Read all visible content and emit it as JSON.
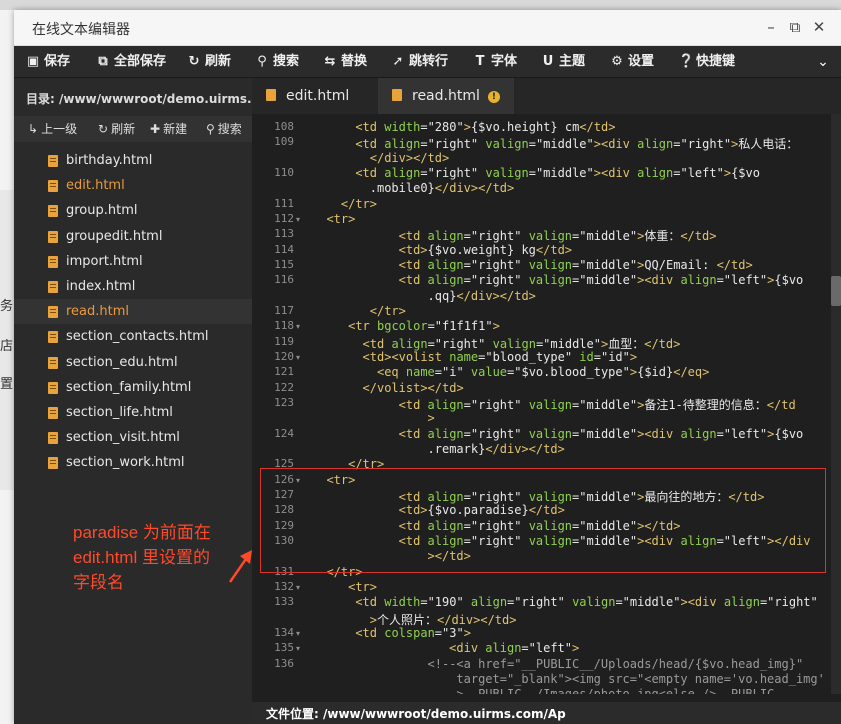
{
  "window": {
    "title": "在线文本编辑器",
    "buttons": [
      "minimize-icon",
      "maximize-icon",
      "close-icon"
    ]
  },
  "background": {
    "left_fragments": [
      "务",
      "店",
      "置"
    ]
  },
  "toolbar": {
    "items": [
      {
        "icon": "save-icon",
        "label": "保存"
      },
      {
        "icon": "save-all-icon",
        "label": "全部保存"
      },
      {
        "icon": "refresh-icon",
        "label": "刷新"
      },
      {
        "icon": "search-icon",
        "label": "搜索"
      },
      {
        "icon": "replace-icon",
        "label": "替换"
      },
      {
        "icon": "goto-line-icon",
        "label": "跳转行"
      },
      {
        "icon": "font-icon",
        "label": "字体"
      },
      {
        "icon": "theme-icon",
        "label": "主题"
      },
      {
        "icon": "gear-icon",
        "label": "设置"
      },
      {
        "icon": "help-icon",
        "label": "快捷键"
      }
    ],
    "collapse_icon": "chevron-down-icon"
  },
  "sidebar": {
    "directory": "目录: /www/wwwroot/demo.uirms.c...",
    "actions": [
      {
        "icon": "up-icon",
        "label": "上一级"
      },
      {
        "icon": "refresh-icon",
        "label": "刷新"
      },
      {
        "icon": "plus-icon",
        "label": "新建"
      },
      {
        "icon": "search-icon",
        "label": "搜索"
      }
    ],
    "files": [
      {
        "name": "birthday.html",
        "state": "normal"
      },
      {
        "name": "edit.html",
        "state": "active"
      },
      {
        "name": "group.html",
        "state": "normal"
      },
      {
        "name": "groupedit.html",
        "state": "normal"
      },
      {
        "name": "import.html",
        "state": "normal"
      },
      {
        "name": "index.html",
        "state": "normal"
      },
      {
        "name": "read.html",
        "state": "open"
      },
      {
        "name": "section_contacts.html",
        "state": "normal"
      },
      {
        "name": "section_edu.html",
        "state": "normal"
      },
      {
        "name": "section_family.html",
        "state": "normal"
      },
      {
        "name": "section_life.html",
        "state": "normal"
      },
      {
        "name": "section_visit.html",
        "state": "normal"
      },
      {
        "name": "section_work.html",
        "state": "normal"
      }
    ]
  },
  "tabs": [
    {
      "label": "edit.html"
    },
    {
      "label": "read.html",
      "modified": "!"
    }
  ],
  "code": {
    "lines": [
      {
        "n": "108",
        "fold": "",
        "ind": 6,
        "segs": [
          [
            "t",
            "<td "
          ],
          [
            "a",
            "width"
          ],
          [
            "s",
            "=\"280\""
          ],
          [
            "t",
            ">"
          ],
          [
            "s",
            "{$vo.height} cm"
          ],
          [
            "t",
            "</td>"
          ]
        ]
      },
      {
        "n": "109",
        "fold": "",
        "ind": 6,
        "segs": [
          [
            "t",
            "<td "
          ],
          [
            "a",
            "align"
          ],
          [
            "s",
            "=\"right\" "
          ],
          [
            "a",
            "valign"
          ],
          [
            "s",
            "=\"middle\""
          ],
          [
            "t",
            ">"
          ],
          [
            "t",
            "<div "
          ],
          [
            "a",
            "align"
          ],
          [
            "s",
            "=\"right\""
          ],
          [
            "t",
            ">"
          ],
          [
            "s",
            "私人电话："
          ]
        ]
      },
      {
        "n": "",
        "fold": "",
        "ind": 8,
        "segs": [
          [
            "t",
            "</div></td>"
          ]
        ]
      },
      {
        "n": "110",
        "fold": "",
        "ind": 6,
        "segs": [
          [
            "t",
            "<td "
          ],
          [
            "a",
            "align"
          ],
          [
            "s",
            "=\"right\" "
          ],
          [
            "a",
            "valign"
          ],
          [
            "s",
            "=\"middle\""
          ],
          [
            "t",
            ">"
          ],
          [
            "t",
            "<div "
          ],
          [
            "a",
            "align"
          ],
          [
            "s",
            "=\"left\""
          ],
          [
            "t",
            ">"
          ],
          [
            "s",
            "{$vo"
          ]
        ]
      },
      {
        "n": "",
        "fold": "",
        "ind": 8,
        "segs": [
          [
            "s",
            ".mobile0}"
          ],
          [
            "t",
            "</div></td>"
          ]
        ]
      },
      {
        "n": "111",
        "fold": "",
        "ind": 4,
        "segs": [
          [
            "t",
            "</tr>"
          ]
        ]
      },
      {
        "n": "112",
        "fold": "▾",
        "ind": 2,
        "segs": [
          [
            "t",
            "<tr>"
          ]
        ]
      },
      {
        "n": "113",
        "fold": "",
        "ind": 12,
        "segs": [
          [
            "t",
            "<td "
          ],
          [
            "a",
            "align"
          ],
          [
            "s",
            "=\"right\" "
          ],
          [
            "a",
            "valign"
          ],
          [
            "s",
            "=\"middle\""
          ],
          [
            "t",
            ">"
          ],
          [
            "s",
            "体重："
          ],
          [
            "t",
            "</td>"
          ]
        ]
      },
      {
        "n": "114",
        "fold": "",
        "ind": 12,
        "segs": [
          [
            "t",
            "<td>"
          ],
          [
            "s",
            "{$vo.weight} kg"
          ],
          [
            "t",
            "</td>"
          ]
        ]
      },
      {
        "n": "115",
        "fold": "",
        "ind": 12,
        "segs": [
          [
            "t",
            "<td "
          ],
          [
            "a",
            "align"
          ],
          [
            "s",
            "=\"right\" "
          ],
          [
            "a",
            "valign"
          ],
          [
            "s",
            "=\"middle\""
          ],
          [
            "t",
            ">"
          ],
          [
            "s",
            "QQ/Email: "
          ],
          [
            "t",
            "</td>"
          ]
        ]
      },
      {
        "n": "116",
        "fold": "",
        "ind": 12,
        "segs": [
          [
            "t",
            "<td "
          ],
          [
            "a",
            "align"
          ],
          [
            "s",
            "=\"right\" "
          ],
          [
            "a",
            "valign"
          ],
          [
            "s",
            "=\"middle\""
          ],
          [
            "t",
            ">"
          ],
          [
            "t",
            "<div "
          ],
          [
            "a",
            "align"
          ],
          [
            "s",
            "=\"left\""
          ],
          [
            "t",
            ">"
          ],
          [
            "s",
            "{$vo"
          ]
        ]
      },
      {
        "n": "",
        "fold": "",
        "ind": 16,
        "segs": [
          [
            "s",
            ".qq}"
          ],
          [
            "t",
            "</div></td>"
          ]
        ]
      },
      {
        "n": "117",
        "fold": "",
        "ind": 8,
        "segs": [
          [
            "t",
            "</tr>"
          ]
        ]
      },
      {
        "n": "118",
        "fold": "▾",
        "ind": 5,
        "segs": [
          [
            "t",
            "<tr "
          ],
          [
            "a",
            "bgcolor"
          ],
          [
            "s",
            "=\"f1f1f1\""
          ],
          [
            "t",
            ">"
          ]
        ]
      },
      {
        "n": "119",
        "fold": "",
        "ind": 7,
        "segs": [
          [
            "t",
            "<td "
          ],
          [
            "a",
            "align"
          ],
          [
            "s",
            "=\"right\" "
          ],
          [
            "a",
            "valign"
          ],
          [
            "s",
            "=\"middle\""
          ],
          [
            "t",
            ">"
          ],
          [
            "s",
            "血型："
          ],
          [
            "t",
            "</td>"
          ]
        ]
      },
      {
        "n": "120",
        "fold": "▾",
        "ind": 7,
        "segs": [
          [
            "t",
            "<td>"
          ],
          [
            "t",
            "<volist "
          ],
          [
            "a",
            "name"
          ],
          [
            "s",
            "=\"blood_type\" "
          ],
          [
            "a",
            "id"
          ],
          [
            "s",
            "=\"id\""
          ],
          [
            "t",
            ">"
          ]
        ]
      },
      {
        "n": "121",
        "fold": "",
        "ind": 9,
        "segs": [
          [
            "t",
            "<eq "
          ],
          [
            "a",
            "name"
          ],
          [
            "s",
            "=\"i\" "
          ],
          [
            "a",
            "value"
          ],
          [
            "s",
            "=\"$vo.blood_type\""
          ],
          [
            "t",
            ">"
          ],
          [
            "s",
            "{$id}"
          ],
          [
            "t",
            "</eq>"
          ]
        ]
      },
      {
        "n": "122",
        "fold": "",
        "ind": 7,
        "segs": [
          [
            "t",
            "</volist></td>"
          ]
        ]
      },
      {
        "n": "123",
        "fold": "",
        "ind": 12,
        "segs": [
          [
            "t",
            "<td "
          ],
          [
            "a",
            "align"
          ],
          [
            "s",
            "=\"right\" "
          ],
          [
            "a",
            "valign"
          ],
          [
            "s",
            "=\"middle\""
          ],
          [
            "t",
            ">"
          ],
          [
            "s",
            "备注1-待整理的信息："
          ],
          [
            "t",
            "</td"
          ]
        ]
      },
      {
        "n": "",
        "fold": "",
        "ind": 16,
        "segs": [
          [
            "t",
            ">"
          ]
        ]
      },
      {
        "n": "124",
        "fold": "",
        "ind": 12,
        "segs": [
          [
            "t",
            "<td "
          ],
          [
            "a",
            "align"
          ],
          [
            "s",
            "=\"right\" "
          ],
          [
            "a",
            "valign"
          ],
          [
            "s",
            "=\"middle\""
          ],
          [
            "t",
            ">"
          ],
          [
            "t",
            "<div "
          ],
          [
            "a",
            "align"
          ],
          [
            "s",
            "=\"left\""
          ],
          [
            "t",
            ">"
          ],
          [
            "s",
            "{$vo"
          ]
        ]
      },
      {
        "n": "",
        "fold": "",
        "ind": 16,
        "segs": [
          [
            "s",
            ".remark}"
          ],
          [
            "t",
            "</div></td>"
          ]
        ]
      },
      {
        "n": "125",
        "fold": "",
        "ind": 5,
        "segs": [
          [
            "t",
            "</tr>"
          ]
        ]
      },
      {
        "n": "126",
        "fold": "▾",
        "ind": 2,
        "segs": [
          [
            "t",
            "<tr>"
          ]
        ]
      },
      {
        "n": "127",
        "fold": "",
        "ind": 12,
        "segs": [
          [
            "t",
            "<td "
          ],
          [
            "a",
            "align"
          ],
          [
            "s",
            "=\"right\" "
          ],
          [
            "a",
            "valign"
          ],
          [
            "s",
            "=\"middle\""
          ],
          [
            "t",
            ">"
          ],
          [
            "s",
            "最向往的地方："
          ],
          [
            "t",
            "</td>"
          ]
        ]
      },
      {
        "n": "128",
        "fold": "",
        "ind": 12,
        "segs": [
          [
            "t",
            "<td>"
          ],
          [
            "s",
            "{$vo.paradise}"
          ],
          [
            "t",
            "</td>"
          ]
        ]
      },
      {
        "n": "129",
        "fold": "",
        "ind": 12,
        "segs": [
          [
            "t",
            "<td "
          ],
          [
            "a",
            "align"
          ],
          [
            "s",
            "=\"right\" "
          ],
          [
            "a",
            "valign"
          ],
          [
            "s",
            "=\"middle\""
          ],
          [
            "t",
            "></td>"
          ]
        ]
      },
      {
        "n": "130",
        "fold": "",
        "ind": 12,
        "segs": [
          [
            "t",
            "<td "
          ],
          [
            "a",
            "align"
          ],
          [
            "s",
            "=\"right\" "
          ],
          [
            "a",
            "valign"
          ],
          [
            "s",
            "=\"middle\""
          ],
          [
            "t",
            ">"
          ],
          [
            "t",
            "<div "
          ],
          [
            "a",
            "align"
          ],
          [
            "s",
            "=\"left\""
          ],
          [
            "t",
            "></div"
          ]
        ]
      },
      {
        "n": "",
        "fold": "",
        "ind": 16,
        "segs": [
          [
            "t",
            "></td>"
          ]
        ]
      },
      {
        "n": "131",
        "fold": "",
        "ind": 2,
        "segs": [
          [
            "t",
            "</tr>"
          ]
        ]
      },
      {
        "n": "132",
        "fold": "▾",
        "ind": 5,
        "segs": [
          [
            "t",
            "<tr>"
          ]
        ]
      },
      {
        "n": "133",
        "fold": "",
        "ind": 6,
        "segs": [
          [
            "t",
            "<td "
          ],
          [
            "a",
            "width"
          ],
          [
            "s",
            "=\"190\" "
          ],
          [
            "a",
            "align"
          ],
          [
            "s",
            "=\"right\" "
          ],
          [
            "a",
            "valign"
          ],
          [
            "s",
            "=\"middle\""
          ],
          [
            "t",
            ">"
          ],
          [
            "t",
            "<div "
          ],
          [
            "a",
            "align"
          ],
          [
            "s",
            "=\"right\""
          ]
        ]
      },
      {
        "n": "",
        "fold": "",
        "ind": 8,
        "segs": [
          [
            "t",
            ">"
          ],
          [
            "s",
            "个人照片："
          ],
          [
            "t",
            "</div></td>"
          ]
        ]
      },
      {
        "n": "134",
        "fold": "▾",
        "ind": 6,
        "segs": [
          [
            "t",
            "<td "
          ],
          [
            "a",
            "colspan"
          ],
          [
            "s",
            "=\"3\""
          ],
          [
            "t",
            ">"
          ]
        ]
      },
      {
        "n": "135",
        "fold": "▾",
        "ind": 19,
        "segs": [
          [
            "t",
            "<div "
          ],
          [
            "a",
            "align"
          ],
          [
            "s",
            "=\"left\""
          ],
          [
            "t",
            ">"
          ]
        ]
      },
      {
        "n": "136",
        "fold": "",
        "ind": 16,
        "segs": [
          [
            "cm",
            "<!--<a href=\"__PUBLIC__/Uploads/head/{$vo.head_img}\""
          ]
        ]
      },
      {
        "n": "",
        "fold": "",
        "ind": 20,
        "segs": [
          [
            "cm",
            "target=\"_blank\"><img src=\"<empty name='vo.head_img'"
          ]
        ]
      },
      {
        "n": "",
        "fold": "",
        "ind": 20,
        "segs": [
          [
            "cm",
            ">  PUBLIC  /Images/photo.jpg<else />  PUBLIC"
          ]
        ]
      }
    ]
  },
  "statusbar": {
    "label": "文件位置: /www/wwwroot/demo.uirms.com/Ap"
  },
  "annotation": {
    "text": "paradise 为前面在\nedit.html 里设置的\n字段名"
  }
}
